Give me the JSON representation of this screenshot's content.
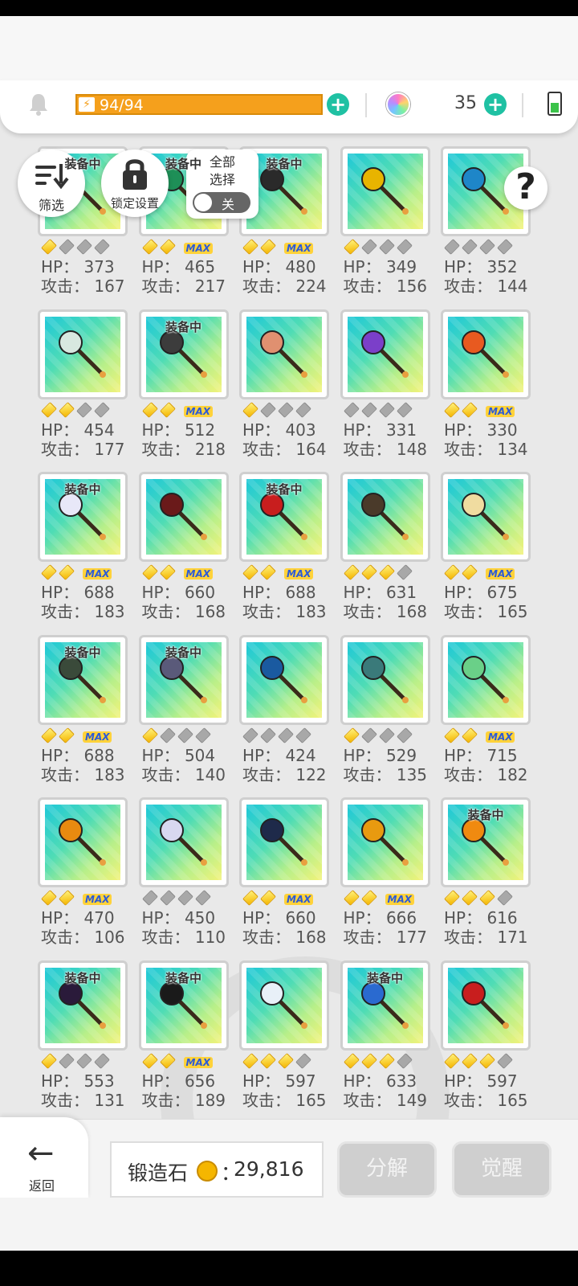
{
  "status": {
    "energy_text": "94/94",
    "energy_max": 94,
    "energy_value": 94,
    "gem_count": "35"
  },
  "controls": {
    "filter_label": "筛选",
    "lock_label": "锁定设置",
    "select_all_label": "全部\n选择",
    "toggle_label": "关",
    "help_label": "?"
  },
  "equipped_label": "装备中",
  "max_label": "MAX",
  "hp_prefix": "HP：",
  "atk_prefix": "攻击：",
  "items": [
    {
      "hp": "373",
      "atk": "167",
      "stars": 1,
      "max": false,
      "equipped": true,
      "color": "#3a2c2c"
    },
    {
      "hp": "465",
      "atk": "217",
      "stars": 2,
      "max": true,
      "equipped": true,
      "color": "#1e8f57"
    },
    {
      "hp": "480",
      "atk": "224",
      "stars": 2,
      "max": true,
      "equipped": true,
      "color": "#2a2a2a"
    },
    {
      "hp": "349",
      "atk": "156",
      "stars": 1,
      "max": false,
      "equipped": false,
      "color": "#e8b400"
    },
    {
      "hp": "352",
      "atk": "144",
      "stars": 0,
      "max": false,
      "equipped": false,
      "color": "#1e86c8"
    },
    {
      "hp": "454",
      "atk": "177",
      "stars": 2,
      "max": false,
      "equipped": false,
      "color": "#d8e8e0"
    },
    {
      "hp": "512",
      "atk": "218",
      "stars": 2,
      "max": true,
      "equipped": true,
      "color": "#3c3c3c"
    },
    {
      "hp": "403",
      "atk": "164",
      "stars": 1,
      "max": false,
      "equipped": false,
      "color": "#e09070"
    },
    {
      "hp": "331",
      "atk": "148",
      "stars": 0,
      "max": false,
      "equipped": false,
      "color": "#7b3fc9"
    },
    {
      "hp": "330",
      "atk": "134",
      "stars": 2,
      "max": true,
      "equipped": false,
      "color": "#e85a20"
    },
    {
      "hp": "688",
      "atk": "183",
      "stars": 2,
      "max": true,
      "equipped": true,
      "color": "#e8e8f8"
    },
    {
      "hp": "660",
      "atk": "168",
      "stars": 2,
      "max": true,
      "equipped": false,
      "color": "#6a1a1a"
    },
    {
      "hp": "688",
      "atk": "183",
      "stars": 2,
      "max": true,
      "equipped": true,
      "color": "#c81e1e"
    },
    {
      "hp": "631",
      "atk": "168",
      "stars": 3,
      "max": false,
      "equipped": false,
      "color": "#4a3a2a"
    },
    {
      "hp": "675",
      "atk": "165",
      "stars": 2,
      "max": true,
      "equipped": false,
      "color": "#f0dca0"
    },
    {
      "hp": "688",
      "atk": "183",
      "stars": 2,
      "max": true,
      "equipped": true,
      "color": "#3a4a3a"
    },
    {
      "hp": "504",
      "atk": "140",
      "stars": 1,
      "max": false,
      "equipped": true,
      "color": "#5a5a7a"
    },
    {
      "hp": "424",
      "atk": "122",
      "stars": 0,
      "max": false,
      "equipped": false,
      "color": "#1a5aa0"
    },
    {
      "hp": "529",
      "atk": "135",
      "stars": 1,
      "max": false,
      "equipped": false,
      "color": "#3a7a7a"
    },
    {
      "hp": "715",
      "atk": "182",
      "stars": 2,
      "max": true,
      "equipped": false,
      "color": "#6ad088"
    },
    {
      "hp": "470",
      "atk": "106",
      "stars": 2,
      "max": true,
      "equipped": false,
      "color": "#e88a10"
    },
    {
      "hp": "450",
      "atk": "110",
      "stars": 0,
      "max": false,
      "equipped": false,
      "color": "#d8d8f0"
    },
    {
      "hp": "660",
      "atk": "168",
      "stars": 2,
      "max": true,
      "equipped": false,
      "color": "#1e2a4a"
    },
    {
      "hp": "666",
      "atk": "177",
      "stars": 2,
      "max": true,
      "equipped": false,
      "color": "#e89a10"
    },
    {
      "hp": "616",
      "atk": "171",
      "stars": 3,
      "max": false,
      "equipped": true,
      "color": "#f08a10"
    },
    {
      "hp": "553",
      "atk": "131",
      "stars": 1,
      "max": false,
      "equipped": true,
      "color": "#2a1a3a"
    },
    {
      "hp": "656",
      "atk": "189",
      "stars": 2,
      "max": true,
      "equipped": true,
      "color": "#1a1a1a"
    },
    {
      "hp": "597",
      "atk": "165",
      "stars": 3,
      "max": false,
      "equipped": false,
      "color": "#e8f0f8"
    },
    {
      "hp": "633",
      "atk": "149",
      "stars": 3,
      "max": false,
      "equipped": true,
      "color": "#2a6ad0"
    },
    {
      "hp": "597",
      "atk": "165",
      "stars": 3,
      "max": false,
      "equipped": false,
      "color": "#c81e1e"
    }
  ],
  "bottom": {
    "back_label": "返回",
    "forge_label": "锻造石",
    "forge_colon": "：",
    "forge_value": "29,816",
    "decompose_label": "分解",
    "awaken_label": "觉醒"
  }
}
